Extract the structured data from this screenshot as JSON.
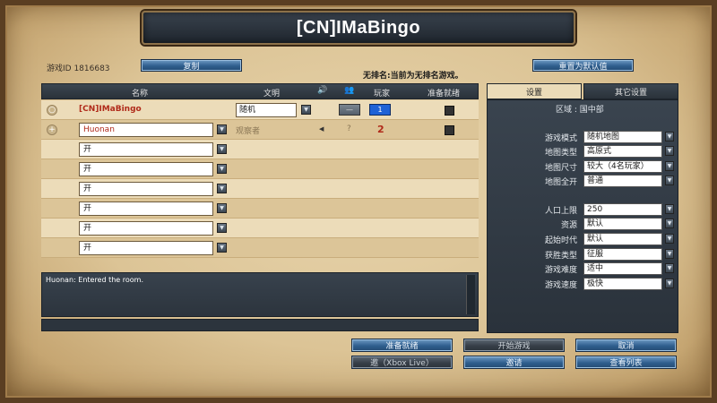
{
  "title": "[CN]IMaBingo",
  "game_id_label": "游戏ID 1816683",
  "copy_button": "复制",
  "reset_default_button": "重置为默认值",
  "notice": "无排名:当前为无排名游戏。",
  "table_headers": {
    "name": "名称",
    "civ": "文明",
    "team": "玩家",
    "ready": "准备就绪"
  },
  "host": {
    "name": "[CN]IMaBingo",
    "civ": "随机",
    "color_number": "1"
  },
  "observer": {
    "name": "Huonan",
    "role": "观察者",
    "team": "?",
    "number": "2"
  },
  "open_slots": [
    "开",
    "开",
    "开",
    "开",
    "开",
    "开"
  ],
  "chat_message": "Huonan: Entered the room.",
  "tabs": {
    "settings": "设置",
    "other_settings": "其它设置"
  },
  "region": "区域 : 国中部",
  "settings": [
    {
      "label": "游戏模式",
      "value": "随机地图"
    },
    {
      "label": "地图类型",
      "value": "高原式"
    },
    {
      "label": "地图尺寸",
      "value": "较大（4名玩家）"
    },
    {
      "label": "地图全开",
      "value": "普通"
    },
    {
      "label": "人口上限",
      "value": "250"
    },
    {
      "label": "资源",
      "value": "默认"
    },
    {
      "label": "起始时代",
      "value": "默认"
    },
    {
      "label": "获胜类型",
      "value": "征服"
    },
    {
      "label": "游戏难度",
      "value": "适中"
    },
    {
      "label": "游戏速度",
      "value": "极快"
    }
  ],
  "bottom_buttons": {
    "ready": "准备就绪",
    "start": "开始游戏",
    "cancel": "取消",
    "invite_xbox": "邀（Xbox Live）",
    "invite": "邀请",
    "view_list": "查看列表"
  },
  "colors": {
    "player_blue": "#1f62d6",
    "host_red": "#b02a1a",
    "button_blue": "#2f5e8e",
    "panel_dark": "#2c343d",
    "parchment": "#e8d5ad"
  }
}
